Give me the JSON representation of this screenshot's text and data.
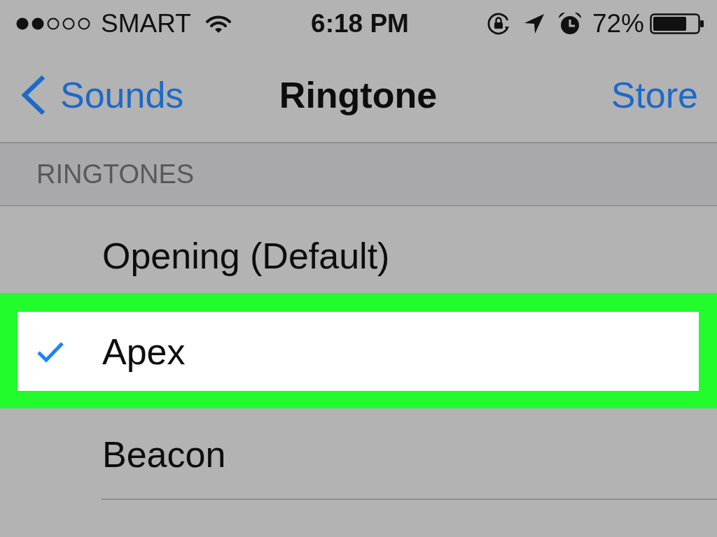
{
  "status_bar": {
    "carrier": "SMART",
    "time": "6:18 PM",
    "battery": "72%"
  },
  "nav_bar": {
    "back": "Sounds",
    "title": "Ringtone",
    "action": "Store"
  },
  "section": {
    "header": "RINGTONES"
  },
  "ringtones": [
    {
      "name": "Opening (Default)",
      "selected": false,
      "highlighted": false
    },
    {
      "name": "Apex",
      "selected": true,
      "highlighted": true
    },
    {
      "name": "Beacon",
      "selected": false,
      "highlighted": false
    }
  ]
}
